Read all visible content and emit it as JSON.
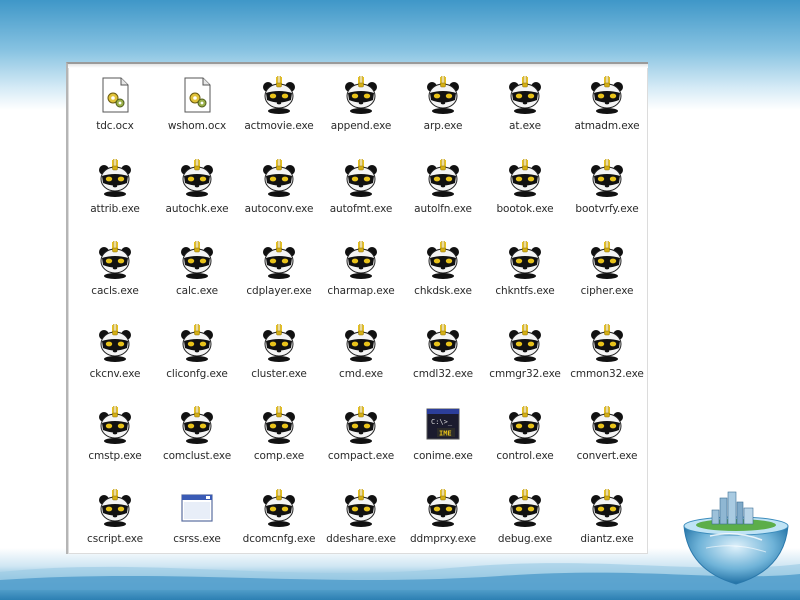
{
  "files": [
    {
      "label": "tdc.ocx",
      "icon": "ocx-document-icon"
    },
    {
      "label": "wshom.ocx",
      "icon": "ocx-document-icon"
    },
    {
      "label": "actmovie.exe",
      "icon": "panda-virus-icon"
    },
    {
      "label": "append.exe",
      "icon": "panda-virus-icon"
    },
    {
      "label": "arp.exe",
      "icon": "panda-virus-icon"
    },
    {
      "label": "at.exe",
      "icon": "panda-virus-icon"
    },
    {
      "label": "atmadm.exe",
      "icon": "panda-virus-icon"
    },
    {
      "label": "attrib.exe",
      "icon": "panda-virus-icon"
    },
    {
      "label": "autochk.exe",
      "icon": "panda-virus-icon"
    },
    {
      "label": "autoconv.exe",
      "icon": "panda-virus-icon"
    },
    {
      "label": "autofmt.exe",
      "icon": "panda-virus-icon"
    },
    {
      "label": "autolfn.exe",
      "icon": "panda-virus-icon"
    },
    {
      "label": "bootok.exe",
      "icon": "panda-virus-icon"
    },
    {
      "label": "bootvrfy.exe",
      "icon": "panda-virus-icon"
    },
    {
      "label": "cacls.exe",
      "icon": "panda-virus-icon"
    },
    {
      "label": "calc.exe",
      "icon": "panda-virus-icon"
    },
    {
      "label": "cdplayer.exe",
      "icon": "panda-virus-icon"
    },
    {
      "label": "charmap.exe",
      "icon": "panda-virus-icon"
    },
    {
      "label": "chkdsk.exe",
      "icon": "panda-virus-icon"
    },
    {
      "label": "chkntfs.exe",
      "icon": "panda-virus-icon"
    },
    {
      "label": "cipher.exe",
      "icon": "panda-virus-icon"
    },
    {
      "label": "ckcnv.exe",
      "icon": "panda-virus-icon"
    },
    {
      "label": "cliconfg.exe",
      "icon": "panda-virus-icon"
    },
    {
      "label": "cluster.exe",
      "icon": "panda-virus-icon"
    },
    {
      "label": "cmd.exe",
      "icon": "panda-virus-icon"
    },
    {
      "label": "cmdl32.exe",
      "icon": "panda-virus-icon"
    },
    {
      "label": "cmmgr32.exe",
      "icon": "panda-virus-icon"
    },
    {
      "label": "cmmon32.exe",
      "icon": "panda-virus-icon"
    },
    {
      "label": "cmstp.exe",
      "icon": "panda-virus-icon"
    },
    {
      "label": "comclust.exe",
      "icon": "panda-virus-icon"
    },
    {
      "label": "comp.exe",
      "icon": "panda-virus-icon"
    },
    {
      "label": "compact.exe",
      "icon": "panda-virus-icon"
    },
    {
      "label": "conime.exe",
      "icon": "console-ime-icon"
    },
    {
      "label": "control.exe",
      "icon": "panda-virus-icon"
    },
    {
      "label": "convert.exe",
      "icon": "panda-virus-icon"
    },
    {
      "label": "cscript.exe",
      "icon": "panda-virus-icon"
    },
    {
      "label": "csrss.exe",
      "icon": "application-window-icon"
    },
    {
      "label": "dcomcnfg.exe",
      "icon": "panda-virus-icon"
    },
    {
      "label": "ddeshare.exe",
      "icon": "panda-virus-icon"
    },
    {
      "label": "ddmprxy.exe",
      "icon": "panda-virus-icon"
    },
    {
      "label": "debug.exe",
      "icon": "panda-virus-icon"
    },
    {
      "label": "diantz.exe",
      "icon": "panda-virus-icon"
    }
  ],
  "colors": {
    "header_blue": "#3f97c8",
    "footer_blue": "#2c7fb2",
    "label_text": "#2a2a2a",
    "incense_yellow": "#e8c21a"
  }
}
